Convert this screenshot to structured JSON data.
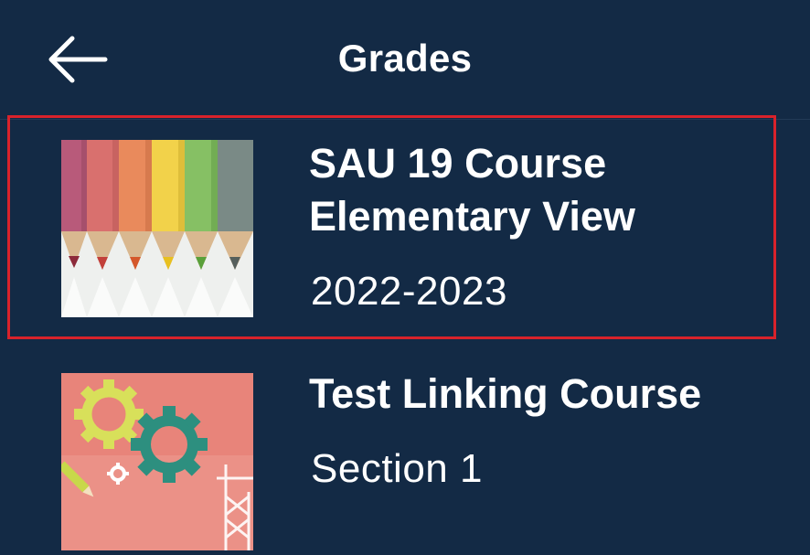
{
  "header": {
    "title": "Grades",
    "back_icon": "arrow-left-icon"
  },
  "courses": [
    {
      "name": "SAU 19 Course\nElementary View",
      "subtitle": "2022-2023",
      "thumbnail": "colored-pencils-image",
      "selected": true
    },
    {
      "name": "Test Linking Course",
      "subtitle": "Section 1",
      "thumbnail": "gears-illustration-image",
      "selected": false
    }
  ],
  "colors": {
    "background": "#132a45",
    "text": "#ffffff",
    "selection_border": "#d8222b"
  }
}
